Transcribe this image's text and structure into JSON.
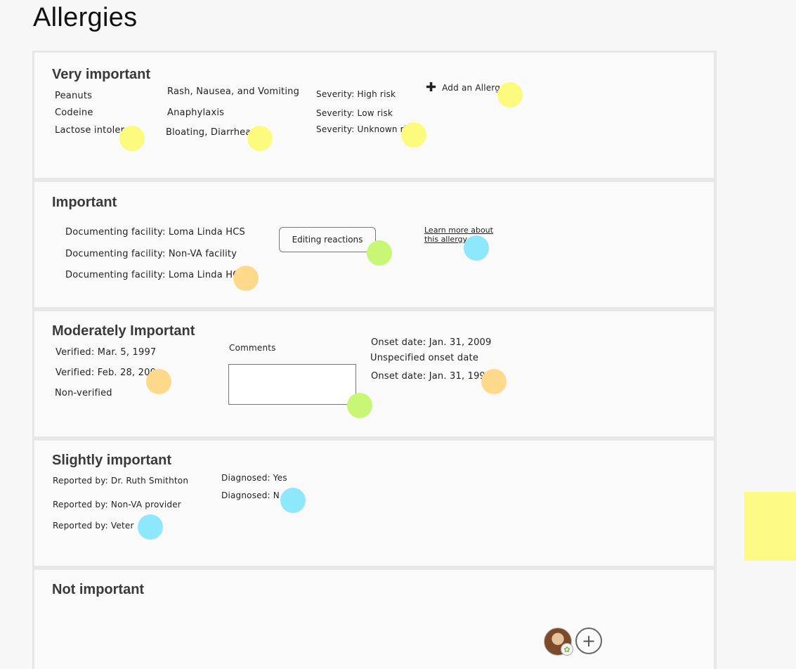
{
  "page": {
    "title": "Allergies"
  },
  "sections": {
    "very_important": {
      "title": "Very important",
      "allergens": [
        "Peanuts",
        "Codeine",
        "Lactose intoler"
      ],
      "reactions": [
        "Rash, Nausea, and Vomiting",
        "Anaphylaxis",
        "Bloating, Diarrhea"
      ],
      "severity": [
        "Severity: High risk",
        "Severity: Low risk",
        "Severity: Unknown ri"
      ],
      "add_allergy": {
        "icon": "plus-icon",
        "label": "Add an Allerg"
      }
    },
    "important": {
      "title": "Important",
      "facilities": [
        "Documenting facility: Loma Linda HCS",
        "Documenting facility: Non-VA facility",
        "Documenting facility: Loma Linda HCS"
      ],
      "edit_button": "Editing reactions",
      "learn_more_line1": "Learn more about",
      "learn_more_line2": "this allergy"
    },
    "moderately_important": {
      "title": "Moderately Important",
      "verification": [
        "Verified: Mar. 5, 1997",
        "Verified: Feb. 28, 200",
        "Non-verified"
      ],
      "comments_label": "Comments",
      "comments_value": "",
      "onset": [
        "Onset date: Jan. 31, 2009",
        "Unspecified onset date",
        "Onset date: Jan. 31, 199"
      ]
    },
    "slightly_important": {
      "title": "Slightly important",
      "reported_by": [
        "Reported by: Dr. Ruth Smithton",
        "Reported by: Non-VA provider",
        "Reported by: Veter"
      ],
      "diagnosed": [
        "Diagnosed: Yes",
        "Diagnosed: N"
      ]
    },
    "not_important": {
      "title": "Not important",
      "add_icon": "plus-icon",
      "avatar_badge_icon": "star-icon"
    }
  },
  "colors": {
    "yellow_dot": "#fdfb7e",
    "green_dot": "#c8f776",
    "orange_dot": "#fed98c",
    "blue_dot": "#8ee8fc",
    "sticky_note": "#fdfb86"
  }
}
